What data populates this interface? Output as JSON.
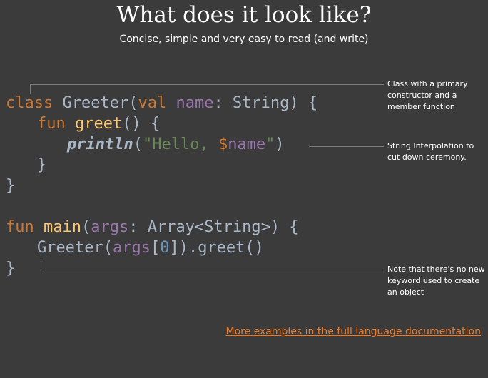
{
  "title": "What does it look like?",
  "subtitle": "Concise, simple and very easy to read (and write)",
  "code": {
    "line1": {
      "class_kw": "class",
      "class_name": " Greeter(",
      "val_kw": "val",
      "param": " name",
      "rest": ": String) {"
    },
    "line2": {
      "fun_kw": "fun",
      "fn_name": " greet",
      "rest": "() {"
    },
    "line3": {
      "call": "println",
      "open": "(",
      "str_start": "\"Hello, ",
      "interp": "$",
      "interp_var": "name",
      "str_end": "\"",
      "close": ")"
    },
    "line4": "}",
    "line5": "}",
    "line6": {
      "fun_kw": "fun",
      "fn_name": " main",
      "open": "(",
      "param": "args",
      "rest": ": Array<String>) {"
    },
    "line7": {
      "cls": "Greeter(",
      "param": "args",
      "bracket_open": "[",
      "num": "0",
      "rest": "]).greet()"
    },
    "line8": "}"
  },
  "notes": {
    "primary_constructor": "Class with a primary constructor and a member function",
    "string_interpolation": "String Interpolation to cut down ceremony.",
    "no_new_keyword": "Note that there's no new keyword used to create an object"
  },
  "link": {
    "label": "More examples in the full language documentation"
  },
  "colors": {
    "background": "#3b3b3c",
    "keyword": "#cc7832",
    "identifier": "#a9b7c6",
    "parameter": "#9876aa",
    "function": "#ffc66d",
    "string": "#6a8759",
    "number": "#6897bb",
    "link": "#e97b2b"
  }
}
